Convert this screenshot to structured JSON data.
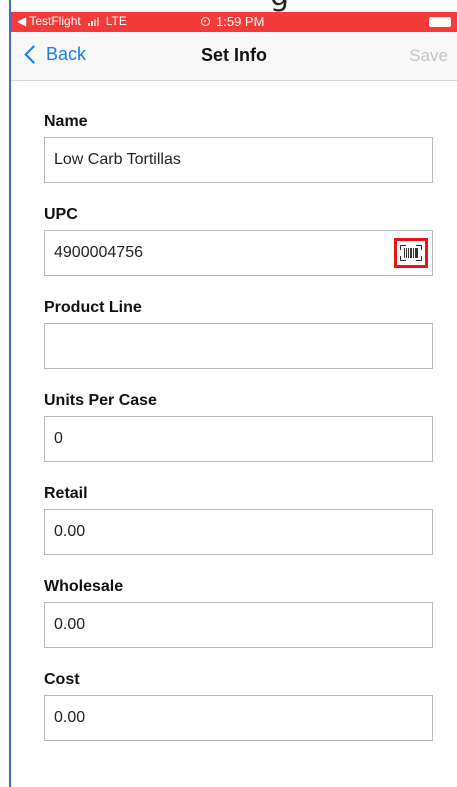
{
  "status_bar": {
    "back_app": "◀ TestFlight",
    "network": "LTE",
    "time": "1:59 PM"
  },
  "nav": {
    "back_label": "Back",
    "title": "Set Info",
    "save_label": "Save"
  },
  "form": {
    "fields": [
      {
        "label": "Name",
        "value": "Low Carb Tortillas",
        "placeholder": ""
      },
      {
        "label": "UPC",
        "value": "4900004756",
        "placeholder": ""
      },
      {
        "label": "Product Line",
        "value": "",
        "placeholder": ""
      },
      {
        "label": "Units Per Case",
        "value": "0",
        "placeholder": ""
      },
      {
        "label": "Retail",
        "value": "0.00",
        "placeholder": ""
      },
      {
        "label": "Wholesale",
        "value": "0.00",
        "placeholder": ""
      },
      {
        "label": "Cost",
        "value": "0.00",
        "placeholder": ""
      }
    ]
  },
  "icons": {
    "scan": "barcode-scan-icon",
    "back": "chevron-left-icon"
  },
  "colors": {
    "status_bar": "#f53b39",
    "accent": "#1a7cf0",
    "highlight": "#e8141c",
    "disabled": "#c4c4c4"
  }
}
